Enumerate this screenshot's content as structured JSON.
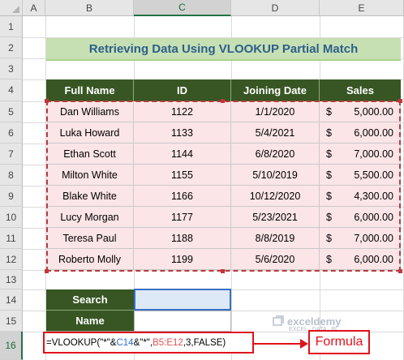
{
  "columns": [
    "A",
    "B",
    "C",
    "D",
    "E"
  ],
  "selected_column": "C",
  "rows": [
    "1",
    "2",
    "3",
    "4",
    "5",
    "6",
    "7",
    "8",
    "9",
    "10",
    "11",
    "12",
    "13",
    "14",
    "15",
    "16"
  ],
  "selected_row": "16",
  "title": "Retrieving Data Using VLOOKUP Partial Match",
  "table": {
    "headers": [
      "Full Name",
      "ID",
      "Joining Date",
      "Sales"
    ],
    "rows": [
      {
        "name": "Dan Williams",
        "id": "1122",
        "date": "1/1/2020",
        "cur": "$",
        "sales": "5,000.00"
      },
      {
        "name": "Luka Howard",
        "id": "1133",
        "date": "5/4/2021",
        "cur": "$",
        "sales": "6,000.00"
      },
      {
        "name": "Ethan Scott",
        "id": "1144",
        "date": "6/8/2020",
        "cur": "$",
        "sales": "7,000.00"
      },
      {
        "name": "Milton White",
        "id": "1155",
        "date": "5/10/2019",
        "cur": "$",
        "sales": "5,500.00"
      },
      {
        "name": "Blake White",
        "id": "1166",
        "date": "10/12/2020",
        "cur": "$",
        "sales": "4,300.00"
      },
      {
        "name": "Lucy Morgan",
        "id": "1177",
        "date": "5/23/2021",
        "cur": "$",
        "sales": "6,000.00"
      },
      {
        "name": "Teresa Paul",
        "id": "1188",
        "date": "8/8/2019",
        "cur": "$",
        "sales": "7,000.00"
      },
      {
        "name": "Roberto Molly",
        "id": "1199",
        "date": "5/6/2020",
        "cur": "$",
        "sales": "6,000.00"
      }
    ]
  },
  "lookup": {
    "search_label": "Search",
    "name_label": "Name",
    "search_value": ""
  },
  "formula": {
    "p1": "=VLOOKUP(\"*\"&",
    "p2": "C14",
    "p3": "&\"*\",",
    "p4": "B5:E12",
    "p5": ",3,FALSE)"
  },
  "formula_label": "Formula",
  "watermark": {
    "name": "exceldemy",
    "tagline": "EXCEL · DATA · BI"
  },
  "colors": {
    "header_green": "#375623",
    "title_band": "#c6e0b4",
    "title_text": "#2e5f8a",
    "row_fill": "#fbe5e7",
    "highlight_red": "#e0121b",
    "ref_blue": "#2f6ad0",
    "ref_red": "#e05151"
  }
}
